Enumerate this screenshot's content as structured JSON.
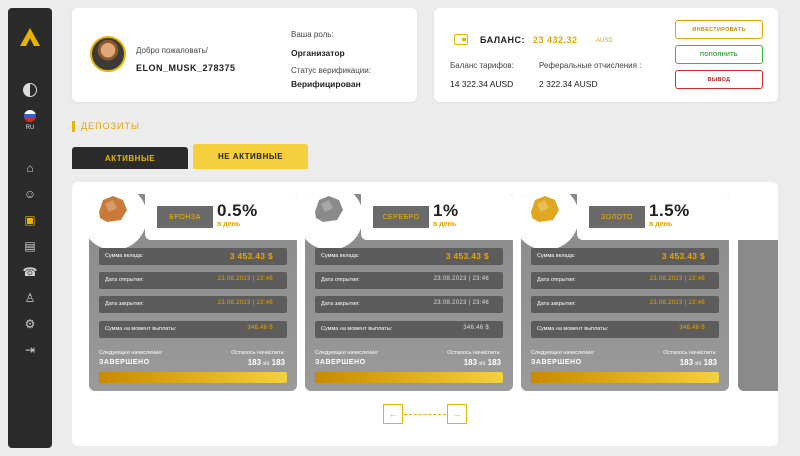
{
  "sidebar": {
    "lang": "RU",
    "items": [
      {
        "name": "home-icon",
        "glyph": "⌂"
      },
      {
        "name": "users-icon",
        "glyph": "☺"
      },
      {
        "name": "deposits-icon",
        "glyph": "▣"
      },
      {
        "name": "document-icon",
        "glyph": "▤"
      },
      {
        "name": "support-icon",
        "glyph": "☎"
      },
      {
        "name": "person-icon",
        "glyph": "♙"
      },
      {
        "name": "settings-icon",
        "glyph": "⚙"
      },
      {
        "name": "logout-icon",
        "glyph": "⇥"
      }
    ]
  },
  "profile": {
    "welcome": "Добро пожаловать/",
    "username": "ELON_MUSK_278375",
    "role_label": "Ваша роль:",
    "role_value": "Организатор",
    "status_label": "Статус верификации:",
    "status_value": "Верифицирован"
  },
  "balance": {
    "title": "БАЛАНС:",
    "amount": "23 432.32",
    "unit": "AUSD",
    "tarif_label": "Баланс тарифов:",
    "tarif_value": "14 322.34 AUSD",
    "ref_label": "Реферальные отчисления :",
    "ref_value": "2 322.34 AUSD",
    "buttons": {
      "invest": "ИНВЕСТИРОВАТЬ",
      "topup": "ПОПОЛНИТЬ",
      "withdraw": "ВЫВОД"
    }
  },
  "section_title": "ДЕПОЗИТЫ",
  "tabs": {
    "active": "АКТИВНЫЕ",
    "inactive": "НЕ АКТИВНЫЕ"
  },
  "labels": {
    "amount": "Сумма вклада:",
    "opened": "Дата открытия:",
    "closed": "Дата закрытия:",
    "payout": "Сумма на момент выплаты:",
    "next": "Следующее начисление:",
    "remaining": "Осталось начислить:",
    "of": "из"
  },
  "deposits": [
    {
      "metal": "БРОНЗА",
      "percent": "0.5%",
      "per_day": "в день",
      "amount": "3 453.43 $",
      "opened": "23.08.2023 | 23:46",
      "closed": "23.08.2023 | 23:46",
      "payout": "346.46 $",
      "next": "ЗАВЕРШЕНО",
      "remaining": "183",
      "total": "183",
      "progress": 1.0,
      "ore_color": "#c97a3a"
    },
    {
      "metal": "СЕРЕБРО",
      "percent": "1%",
      "per_day": "в день",
      "amount": "3 453.43 $",
      "opened": "23.08.2023 | 23:46",
      "closed": "23.08.2023 | 23:46",
      "payout": "346.46 $",
      "next": "ЗАВЕРШЕНО",
      "remaining": "183",
      "total": "183",
      "progress": 1.0,
      "ore_color": "#8a8a8a"
    },
    {
      "metal": "ЗОЛОТО",
      "percent": "1.5%",
      "per_day": "в день",
      "amount": "3 453.43 $",
      "opened": "23.08.2023 | 23:46",
      "closed": "23.08.2023 | 23:46",
      "payout": "346.46 $",
      "next": "ЗАВЕРШЕНО",
      "remaining": "183",
      "total": "183",
      "progress": 1.0,
      "ore_color": "#e0a820"
    }
  ],
  "colors": {
    "accent": "#e8b400",
    "dark": "#2b2b2b",
    "success": "#2fbf2f",
    "danger": "#d02b2b"
  }
}
